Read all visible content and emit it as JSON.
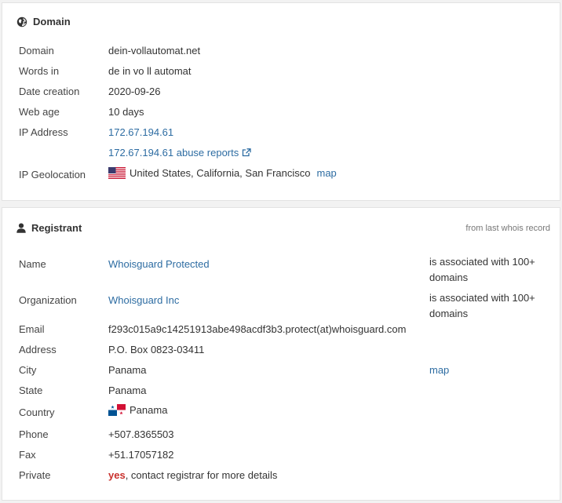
{
  "domain_panel": {
    "title": "Domain",
    "icon": "globe-icon",
    "rows": {
      "domain": {
        "label": "Domain",
        "value": "dein-vollautomat.net"
      },
      "words": {
        "label": "Words in",
        "value": "de in vo ll automat"
      },
      "date_creation": {
        "label": "Date creation",
        "value": "2020-09-26"
      },
      "web_age": {
        "label": "Web age",
        "value": "10 days"
      },
      "ip_address": {
        "label": "IP Address",
        "value": "172.67.194.61",
        "abuse": "172.67.194.61 abuse reports"
      },
      "geo": {
        "label": "IP Geolocation",
        "value": "United States, California, San Francisco",
        "map": "map",
        "flag": "us-flag-icon"
      }
    }
  },
  "registrant_panel": {
    "title": "Registrant",
    "icon": "user-icon",
    "note": "from last whois record",
    "rows": {
      "name": {
        "label": "Name",
        "value": "Whoisguard Protected",
        "extra": "is associated with 100+ domains"
      },
      "organization": {
        "label": "Organization",
        "value": "Whoisguard Inc",
        "extra": "is associated with 100+ domains"
      },
      "email": {
        "label": "Email",
        "value": "f293c015a9c14251913abe498acdf3b3.protect(at)whoisguard.com"
      },
      "address": {
        "label": "Address",
        "value": "P.O. Box 0823-03411"
      },
      "city": {
        "label": "City",
        "value": "Panama",
        "map": "map"
      },
      "state": {
        "label": "State",
        "value": "Panama"
      },
      "country": {
        "label": "Country",
        "value": "Panama",
        "flag": "panama-flag-icon"
      },
      "phone": {
        "label": "Phone",
        "value": "+507.8365503"
      },
      "fax": {
        "label": "Fax",
        "value": "+51.17057182"
      },
      "private": {
        "label": "Private",
        "value_highlight": "yes",
        "value_rest": ", contact registrar for more details"
      }
    }
  },
  "colors": {
    "link": "#2d6ca2",
    "highlight": "#c9302c",
    "panel_border": "#e3e3e3"
  }
}
